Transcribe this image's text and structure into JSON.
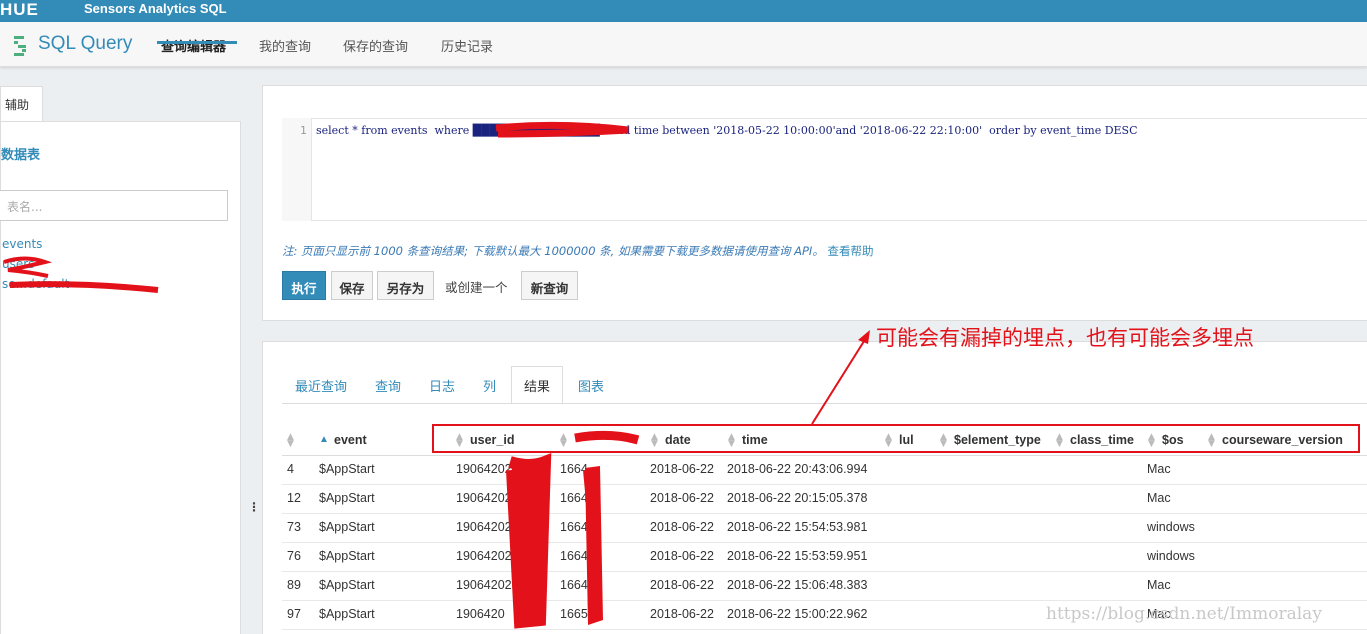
{
  "topbar": {
    "logo": "HUE",
    "app_name": "Sensors Analytics SQL"
  },
  "subnav": {
    "title": "SQL Query",
    "tabs": [
      {
        "label": "查询编辑器",
        "active": true
      },
      {
        "label": "我的查询",
        "active": false
      },
      {
        "label": "保存的查询",
        "active": false
      },
      {
        "label": "历史记录",
        "active": false
      }
    ]
  },
  "sidebar": {
    "tab_label": "辅助",
    "section_title": "数据表",
    "search_placeholder": "表名...",
    "tables": [
      "events",
      "users",
      "se...default"
    ]
  },
  "editor": {
    "line_number": "1",
    "sql": "select * from events  where ███████████████'  and time between '2018-05-22 10:00:00'and '2018-06-22 22:10:00'  order by event_time DESC",
    "note": "注: 页面只显示前 1000 条查询结果; 下载默认最大 1000000 条, 如果需要下载更多数据请使用查询 API。",
    "note_link": "查看帮助",
    "buttons": {
      "execute": "执行",
      "save": "保存",
      "save_as": "另存为",
      "or_create": "或创建一个",
      "new_query": "新查询"
    }
  },
  "results": {
    "tabs": [
      "最近查询",
      "查询",
      "日志",
      "列",
      "结果",
      "图表"
    ],
    "active_tab": "结果",
    "columns": [
      "event",
      "user_id",
      "date",
      "time",
      "lul",
      "$element_type",
      "class_time",
      "$os",
      "courseware_version"
    ],
    "rows": [
      {
        "num": "4",
        "event": "$AppStart",
        "user_id": "19064202",
        "masked": "1664",
        "date": "2018-06-22",
        "time": "2018-06-22 20:43:06.994",
        "os": "Mac"
      },
      {
        "num": "12",
        "event": "$AppStart",
        "user_id": "19064202",
        "masked": "1664",
        "date": "2018-06-22",
        "time": "2018-06-22 20:15:05.378",
        "os": "Mac"
      },
      {
        "num": "73",
        "event": "$AppStart",
        "user_id": "1906420284",
        "masked": "1664",
        "date": "2018-06-22",
        "time": "2018-06-22 15:54:53.981",
        "os": "windows"
      },
      {
        "num": "76",
        "event": "$AppStart",
        "user_id": "19064202",
        "masked": "1664",
        "date": "2018-06-22",
        "time": "2018-06-22 15:53:59.951",
        "os": "windows"
      },
      {
        "num": "89",
        "event": "$AppStart",
        "user_id": "190642028",
        "masked": "1664",
        "date": "2018-06-22",
        "time": "2018-06-22 15:06:48.383",
        "os": "Mac"
      },
      {
        "num": "97",
        "event": "$AppStart",
        "user_id": "1906420",
        "masked": "1665",
        "date": "2018-06-22",
        "time": "2018-06-22 15:00:22.962",
        "os": "Mac"
      }
    ]
  },
  "annotation": {
    "text": "可能会有漏掉的埋点，也有可能会多埋点",
    "color": "#e3121a"
  },
  "watermark": "https://blog.csdn.net/Immoralay",
  "colors": {
    "brand": "#338bb8",
    "annotation": "#e3121a"
  }
}
